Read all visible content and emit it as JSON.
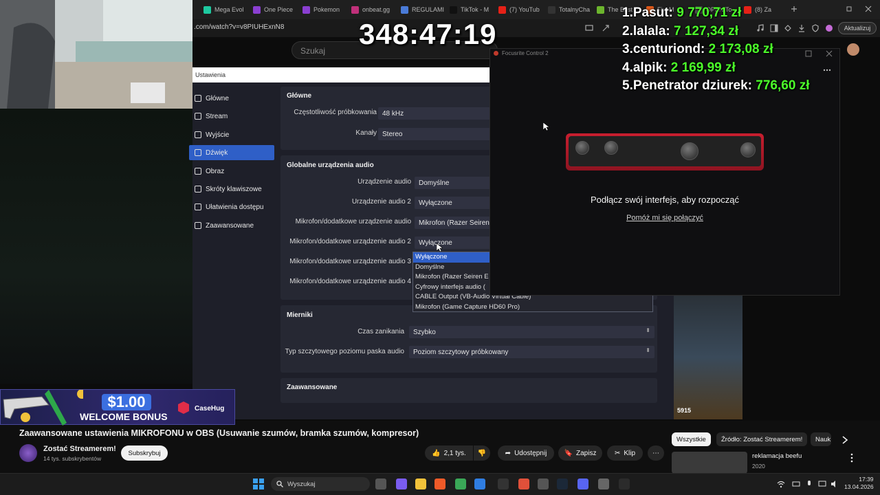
{
  "browser": {
    "tabs": [
      {
        "label": "Mega Evol",
        "color": "#1ec9a0"
      },
      {
        "label": "One Piece",
        "color": "#8a3fd1"
      },
      {
        "label": "Pokemon",
        "color": "#8a3fd1"
      },
      {
        "label": "onbeat.gg",
        "color": "#c0307a"
      },
      {
        "label": "REGULAMI",
        "color": "#4a7bd8"
      },
      {
        "label": "TikTok - M",
        "color": "#111111"
      },
      {
        "label": "(7) YouTub",
        "color": "#e62117"
      },
      {
        "label": "TotalnyCha",
        "color": "#333333"
      },
      {
        "label": "The Best",
        "color": "#6cb52d"
      },
      {
        "label": "FiveM",
        "color": "#e05a1a"
      },
      {
        "label": "OPEN To",
        "color": "#555555"
      },
      {
        "label": "(8) Za",
        "color": "#e62117"
      }
    ],
    "url": ".com/watch?v=v8PIUHExnN8",
    "update_label": "Aktualizuj"
  },
  "youtube": {
    "search_placeholder": "Szukaj",
    "video_title": "Zaawansowane ustawienia MIKROFONU w OBS (Usuwanie szumów, bramka szumów, kompresor)",
    "channel_name": "Zostać Streamerem!",
    "channel_subs": "14 tys. subskrybentów",
    "subscribe_label": "Subskrybuj",
    "likes": "2,1 tys.",
    "share_label": "Udostępnij",
    "save_label": "Zapisz",
    "clip_label": "Klip",
    "chips": [
      "Wszystkie",
      "Źródło: Zostać Streamerem!",
      "Nauk"
    ],
    "recommendation": {
      "title": "reklamacja beefu",
      "year": "2020"
    }
  },
  "obs": {
    "window_title": "Ustawienia",
    "nav": [
      {
        "label": "Główne",
        "active": false
      },
      {
        "label": "Stream",
        "active": false
      },
      {
        "label": "Wyjście",
        "active": false
      },
      {
        "label": "Dźwięk",
        "active": true
      },
      {
        "label": "Obraz",
        "active": false
      },
      {
        "label": "Skróty klawiszowe",
        "active": false
      },
      {
        "label": "Ułatwienia dostępu",
        "active": false
      },
      {
        "label": "Zaawansowane",
        "active": false
      }
    ],
    "general": {
      "title": "Główne",
      "sample_rate_label": "Częstotliwość próbkowania",
      "sample_rate_value": "48 kHz",
      "channels_label": "Kanały",
      "channels_value": "Stereo"
    },
    "global_audio": {
      "title": "Globalne urządzenia audio",
      "rows": [
        {
          "label": "Urządzenie audio",
          "value": "Domyślne"
        },
        {
          "label": "Urządzenie audio 2",
          "value": "Wyłączone"
        },
        {
          "label": "Mikrofon/dodatkowe urządzenie audio",
          "value": "Mikrofon (Razer Seiren E"
        },
        {
          "label": "Mikrofon/dodatkowe urządzenie audio 2",
          "value": "Wyłączone"
        },
        {
          "label": "Mikrofon/dodatkowe urządzenie audio 3",
          "value": ""
        },
        {
          "label": "Mikrofon/dodatkowe urządzenie audio 4",
          "value": ""
        }
      ]
    },
    "dropdown_options": [
      "Wyłączone",
      "Domyślne",
      "Mikrofon (Razer Seiren E",
      "Cyfrowy interfejs audio (",
      "CABLE Output (VB-Audio Virtual Cable)",
      "Mikrofon (Game Capture HD60 Pro)"
    ],
    "meters": {
      "title": "Mierniki",
      "decay_label": "Czas zanikania",
      "decay_value": "Szybko",
      "peak_label": "Typ szczytowego poziomu paska audio",
      "peak_value": "Poziom szczytowy próbkowany"
    },
    "advanced": {
      "title": "Zaawansowane"
    }
  },
  "focusrite": {
    "window_title": "Focusrite Control 2",
    "heading": "Podłącz swój interfejs, aby rozpocząć",
    "help_link": "Pomóż mi się połączyć"
  },
  "overlay": {
    "timer": "348:47:19",
    "leaderboard": [
      {
        "rank": "1.",
        "name": "Pasut:",
        "amount": "9 770,71 zł"
      },
      {
        "rank": "2.",
        "name": "lalala:",
        "amount": "7 127,34 zł"
      },
      {
        "rank": "3.",
        "name": "centuriond:",
        "amount": "2 173,08 zł"
      },
      {
        "rank": "4.",
        "name": "alpik:",
        "amount": "2 169,99 zł"
      },
      {
        "rank": "5.",
        "name": "Penetrator dziurek:",
        "amount": "776,60 zł"
      }
    ],
    "bonus": {
      "amount": "$1.00",
      "text": "WELCOME BONUS",
      "brand": "CaseHug"
    },
    "game_counter": "5915"
  },
  "taskbar": {
    "search_placeholder": "Wyszukaj",
    "time": "17:39",
    "date": "13.04.2026"
  }
}
